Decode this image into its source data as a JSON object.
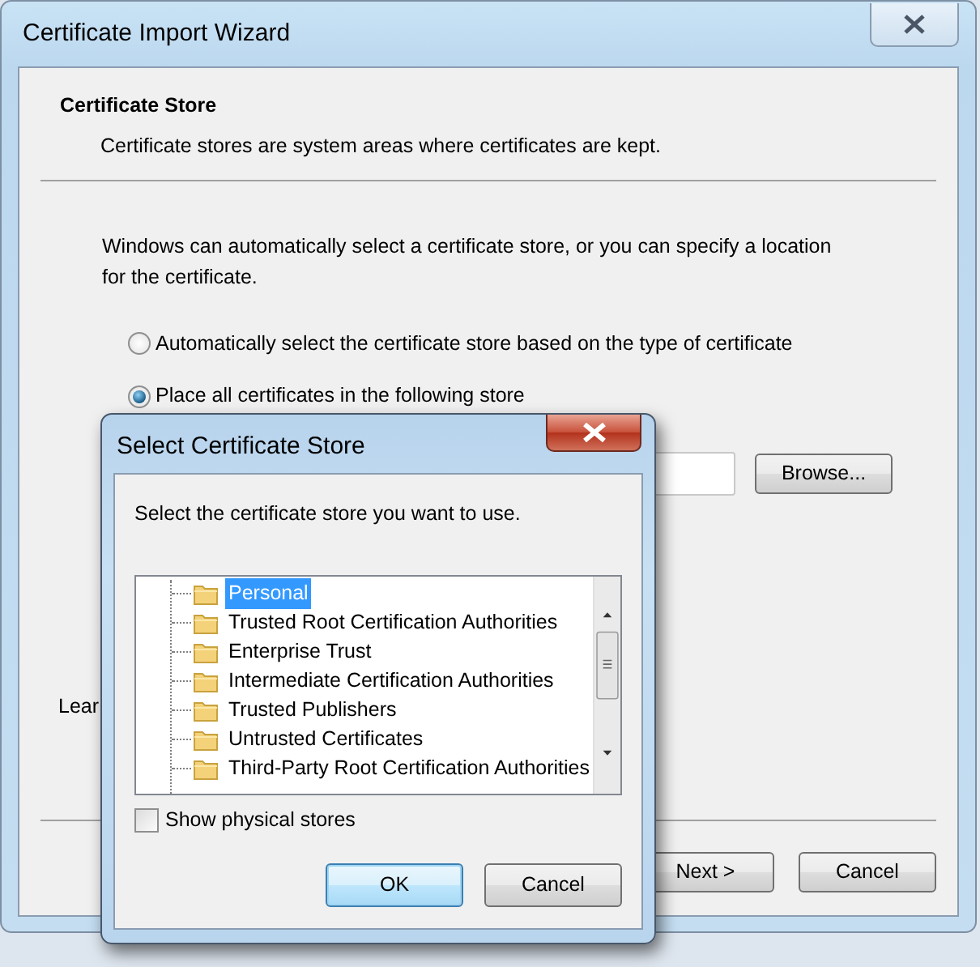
{
  "window": {
    "title": "Certificate Import Wizard"
  },
  "header": {
    "title": "Certificate Store",
    "subtitle": "Certificate stores are system areas where certificates are kept."
  },
  "intro": "Windows can automatically select a certificate store, or you can specify a location for the certificate.",
  "options": [
    {
      "label": "Automatically select the certificate store based on the type of certificate",
      "selected": false
    },
    {
      "label": "Place all certificates in the following store",
      "selected": true
    }
  ],
  "browse_button": "Browse...",
  "learn_link": "Lear",
  "buttons": [
    {
      "label": "Next >",
      "default": false
    },
    {
      "label": "Cancel",
      "default": false
    }
  ],
  "dialog": {
    "title": "Select Certificate Store",
    "prompt": "Select the certificate store you want to use.",
    "stores": [
      {
        "label": "Personal",
        "selected": true
      },
      {
        "label": "Trusted Root Certification Authorities",
        "selected": false
      },
      {
        "label": "Enterprise Trust",
        "selected": false
      },
      {
        "label": "Intermediate Certification Authorities",
        "selected": false
      },
      {
        "label": "Trusted Publishers",
        "selected": false
      },
      {
        "label": "Untrusted Certificates",
        "selected": false
      },
      {
        "label": "Third-Party Root Certification Authorities",
        "selected": false
      }
    ],
    "show_physical_stores": {
      "label": "Show physical stores",
      "checked": false
    },
    "buttons": [
      {
        "label": "OK",
        "default": true
      },
      {
        "label": "Cancel",
        "default": false
      }
    ]
  }
}
